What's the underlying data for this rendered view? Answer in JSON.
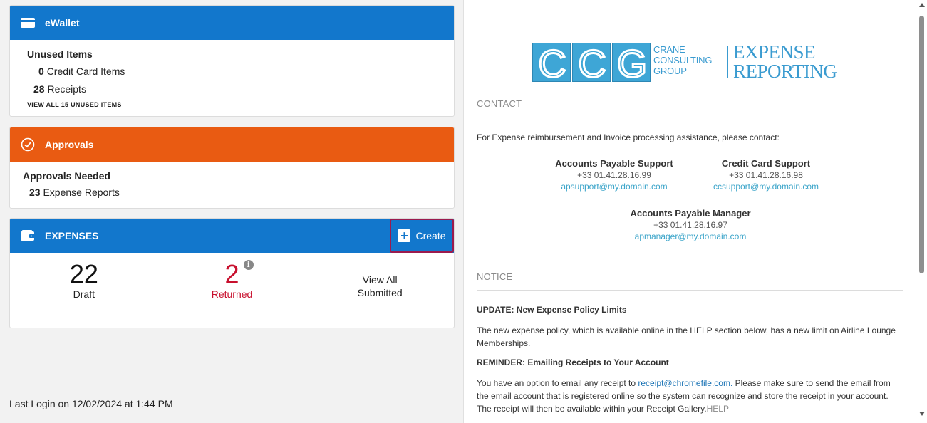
{
  "ewallet": {
    "title": "eWallet",
    "unused_title": "Unused Items",
    "credit_count": "0",
    "credit_label": "Credit Card Items",
    "receipts_count": "28",
    "receipts_label": "Receipts",
    "view_all": "VIEW ALL 15 UNUSED ITEMS"
  },
  "approvals": {
    "title": "Approvals",
    "needed_title": "Approvals Needed",
    "reports_count": "23",
    "reports_label": "Expense Reports"
  },
  "expenses": {
    "title": "EXPENSES",
    "create_label": "Create",
    "draft_count": "22",
    "draft_label": "Draft",
    "returned_count": "2",
    "returned_label": "Returned",
    "view_all_line1": "View All",
    "view_all_line2": "Submitted",
    "info_glyph": "i"
  },
  "last_login": "Last Login on 12/02/2024 at 1:44 PM",
  "logo": {
    "letters": [
      "C",
      "C",
      "G"
    ],
    "small_line1": "CRANE",
    "small_line2": "CONSULTING",
    "small_line3": "GROUP",
    "big_line1": "EXPENSE",
    "big_line2": "REPORTING"
  },
  "contact": {
    "heading": "CONTACT",
    "intro": "For Expense reimbursement and Invoice processing assistance, please contact:",
    "ap_support": {
      "name": "Accounts Payable Support",
      "phone": "+33 01.41.28.16.99",
      "email": "apsupport@my.domain.com"
    },
    "cc_support": {
      "name": "Credit Card Support",
      "phone": "+33 01.41.28.16.98",
      "email": "ccsupport@my.domain.com"
    },
    "ap_manager": {
      "name": "Accounts Payable Manager",
      "phone": "+33 01.41.28.16.97",
      "email": "apmanager@my.domain.com"
    }
  },
  "notice": {
    "heading": "NOTICE",
    "update_title": "UPDATE: New Expense Policy Limits",
    "update_text": "The new expense policy, which is available online in the HELP section below, has a new limit on Airline Lounge Memberships.",
    "reminder_title": "REMINDER: Emailing Receipts to Your Account",
    "reminder_pre": "You have an option to email any receipt to ",
    "reminder_email": "receipt@chromefile.com.",
    "reminder_post": " Please make sure to send the email from the email account that is registered online so the system can recognize and store the receipt in your account. The receipt will then be available within your Receipt Gallery.",
    "help_link": "HELP"
  },
  "colors": {
    "blue_header": "#1277cc",
    "orange_header": "#e95b12",
    "returned_red": "#c8102e",
    "create_border": "#9b1b4e",
    "logo_blue": "#3ea6d6"
  }
}
